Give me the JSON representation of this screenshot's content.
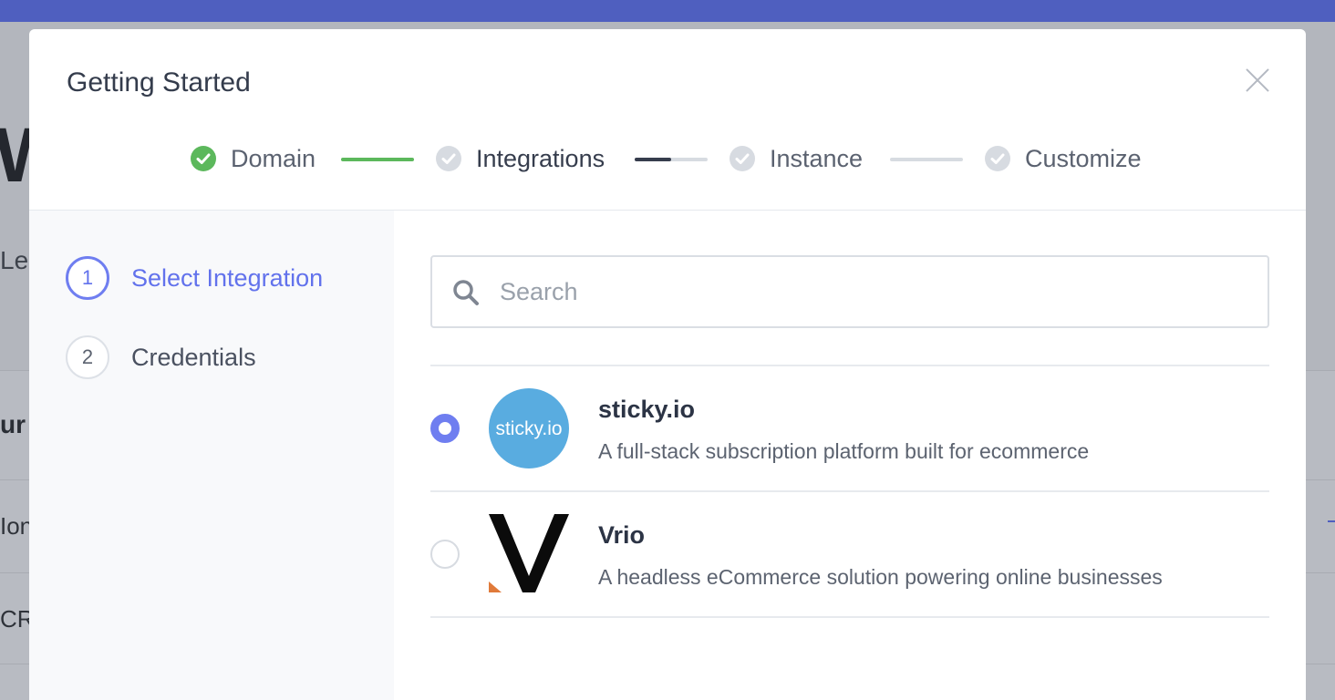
{
  "modal": {
    "title": "Getting Started"
  },
  "stepper": {
    "steps": [
      {
        "label": "Domain",
        "state": "complete"
      },
      {
        "label": "Integrations",
        "state": "active"
      },
      {
        "label": "Instance",
        "state": "pending"
      },
      {
        "label": "Customize",
        "state": "pending"
      }
    ],
    "colors": {
      "complete": "#5cb85c",
      "active": "#363d4d",
      "pending": "#d7dbe1"
    }
  },
  "substeps": [
    {
      "number": "1",
      "label": "Select Integration",
      "active": true
    },
    {
      "number": "2",
      "label": "Credentials",
      "active": false
    }
  ],
  "search": {
    "placeholder": "Search",
    "icon": "search-icon"
  },
  "integrations": [
    {
      "name": "sticky.io",
      "description": "A full-stack subscription platform built for ecommerce",
      "selected": true,
      "logo_text": "sticky.io",
      "logo_color": "#59ace0"
    },
    {
      "name": "Vrio",
      "description": "A headless eCommerce solution powering online businesses",
      "selected": false,
      "logo_color": "#0b0b0b",
      "logo_accent": "#e07a3a"
    }
  ],
  "background": {
    "heading_fragment": "W",
    "text_fragment": "Le",
    "row1": "ur",
    "row2": "Ion",
    "row3": "CRN"
  },
  "accent_color": "#6f7ef0",
  "topbar_color": "#4f5fbf"
}
